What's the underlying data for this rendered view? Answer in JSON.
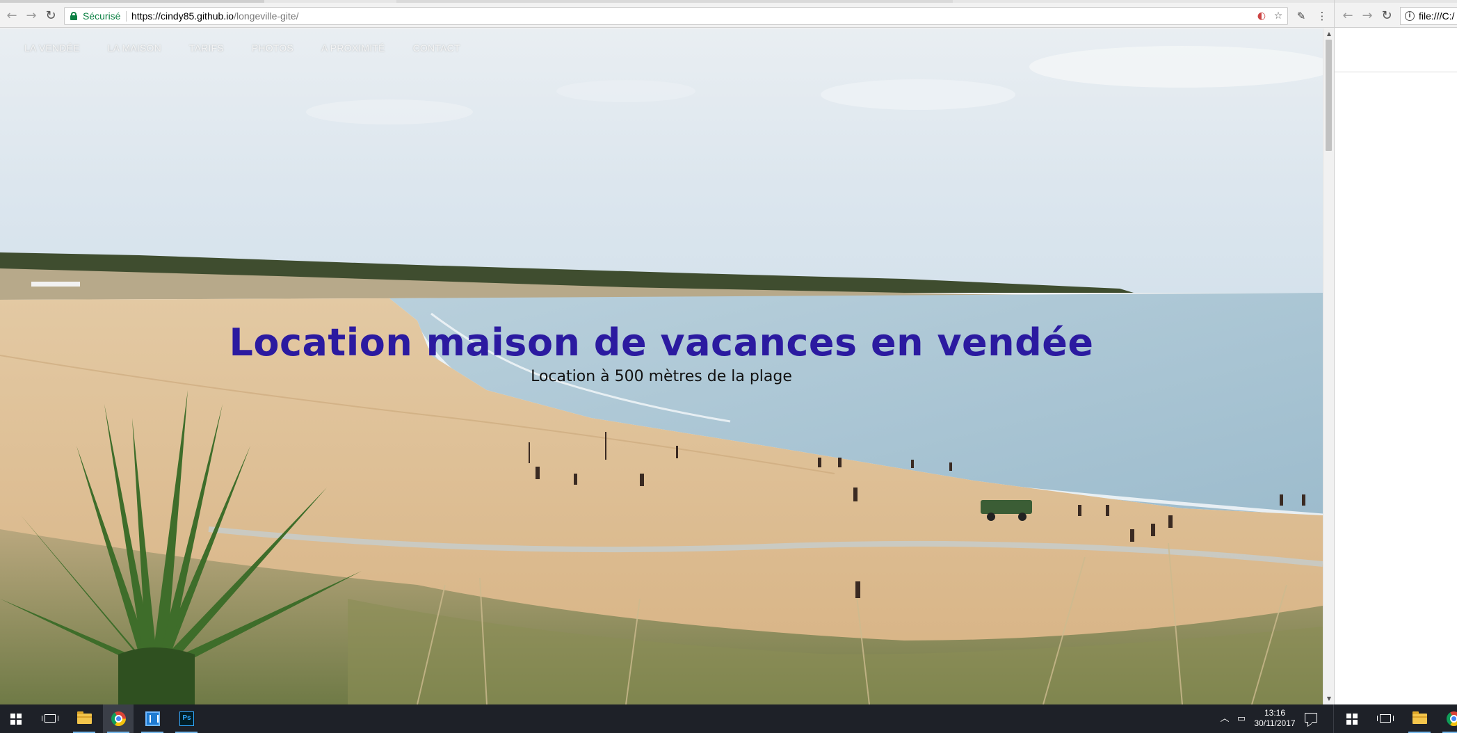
{
  "browser_left": {
    "nav": {
      "back_icon": "back-arrow-icon",
      "forward_icon": "forward-arrow-icon",
      "reload_icon": "reload-icon"
    },
    "omnibox": {
      "secure_label": "Sécurisé",
      "url_host": "https://cindy85.github.io",
      "url_path": "/longeville-gite/",
      "icons": [
        "translate-icon",
        "bookmark-star-icon"
      ]
    },
    "extensions": [
      "eyedropper-icon",
      "menu-kebab-icon"
    ]
  },
  "page": {
    "nav_items": [
      "LA VENDÉE",
      "LA MAISON",
      "TARIFS",
      "PHOTOS",
      "A PROXIMITÉ",
      "CONTACT"
    ],
    "hero_title": "Location maison de vacances en vendée",
    "hero_subtitle": "Location à 500 mètres de la plage",
    "hero_image": "beach-dunes-photo"
  },
  "browser_right": {
    "url_text": "file:///C:/"
  },
  "taskbar": {
    "apps": [
      "windows-start",
      "task-view",
      "file-explorer",
      "google-chrome",
      "brackets",
      "photoshop"
    ],
    "ps_label": "Ps",
    "time": "13:16",
    "date": "30/11/2017",
    "right_apps": [
      "windows-start",
      "task-view",
      "file-explorer",
      "google-chrome"
    ]
  },
  "colors": {
    "title": "#2b1aa0",
    "secure_green": "#0b8043",
    "taskbar": "#1e2128",
    "sand": "#d9b78a",
    "sea": "#a9c6d6",
    "sky": "#dfe8ef"
  }
}
